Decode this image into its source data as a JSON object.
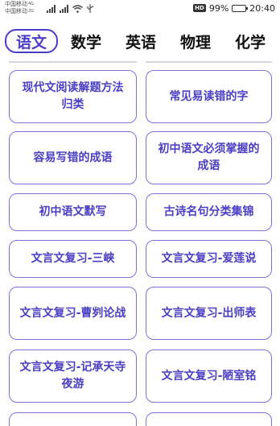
{
  "status_bar": {
    "carrier_1": "中国移动",
    "carrier_2": "中国移动",
    "signal_tag_1": "4G",
    "signal_tag_2": "2G",
    "hd": "HD",
    "battery": "99%",
    "battery_level": 0.99,
    "time": "20:40"
  },
  "tabs": [
    {
      "label": "语文",
      "active": true
    },
    {
      "label": "数学"
    },
    {
      "label": "英语"
    },
    {
      "label": "物理"
    },
    {
      "label": "化学"
    }
  ],
  "items": [
    "现代文阅读解题方法归类",
    "常见易读错的字",
    "容易写错的成语",
    "初中语文必须掌握的成语",
    "初中语文默写",
    "古诗名句分类集锦",
    "文言文复习-三峡",
    "文言文复习-爱莲说",
    "文言文复习-曹刿论战",
    "文言文复习-出师表",
    "文言文复习-记承天寺夜游",
    "文言文复习-陋室铭"
  ],
  "colors": {
    "accent": "#4b3cc9",
    "card_border": "#7d72d8",
    "card_text": "#4a3ec4"
  }
}
